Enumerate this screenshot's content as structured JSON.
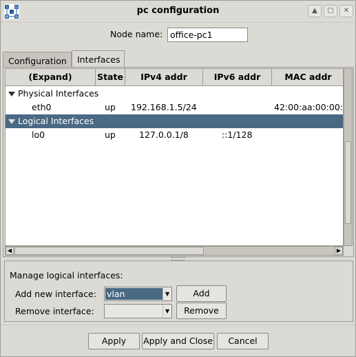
{
  "window": {
    "title": "pc configuration",
    "controls": {
      "up_glyph": "▲",
      "restore_glyph": "▢",
      "close_glyph": "✕"
    }
  },
  "node": {
    "label": "Node name:",
    "value": "office-pc1"
  },
  "tabs": [
    {
      "label": "Configuration",
      "active": false
    },
    {
      "label": "Interfaces",
      "active": true
    }
  ],
  "table": {
    "columns": [
      "(Expand)",
      "State",
      "IPv4 addr",
      "IPv6 addr",
      "MAC addr"
    ],
    "groups": [
      {
        "label": "Physical Interfaces",
        "selected": false,
        "rows": [
          {
            "name": "eth0",
            "state": "up",
            "ipv4": "192.168.1.5/24",
            "ipv6": "",
            "mac": "42:00:aa:00:00:0"
          }
        ]
      },
      {
        "label": "Logical Interfaces",
        "selected": true,
        "rows": [
          {
            "name": "lo0",
            "state": "up",
            "ipv4": "127.0.0.1/8",
            "ipv6": "::1/128",
            "mac": ""
          }
        ]
      }
    ]
  },
  "manage": {
    "title": "Manage logical interfaces:",
    "add_label": "Add new interface:",
    "add_value": "vlan",
    "add_button": "Add",
    "remove_label": "Remove interface:",
    "remove_value": "",
    "remove_button": "Remove"
  },
  "buttons": {
    "apply": "Apply",
    "apply_close": "Apply and Close",
    "cancel": "Cancel"
  },
  "colors": {
    "selection": "#4a6984",
    "background": "#dcdad5"
  }
}
